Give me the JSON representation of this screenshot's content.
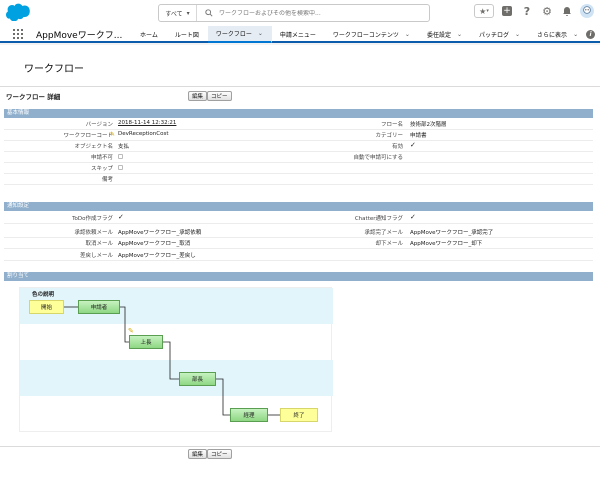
{
  "header": {
    "search_scope": "すべて",
    "search_placeholder": "ワークフローおよびその他を検索中..."
  },
  "nav": {
    "app_name": "AppMoveワークフ...",
    "tabs": [
      {
        "label": "ホーム",
        "has_menu": false
      },
      {
        "label": "ルート図",
        "has_menu": false
      },
      {
        "label": "ワークフロー",
        "has_menu": true,
        "active": true
      },
      {
        "label": "申請メニュー",
        "has_menu": false
      },
      {
        "label": "ワークフローコンテンツ",
        "has_menu": true
      },
      {
        "label": "委任設定",
        "has_menu": true
      },
      {
        "label": "パッチログ",
        "has_menu": true
      },
      {
        "label": "さらに表示",
        "has_menu": true
      }
    ]
  },
  "page": {
    "title": "ワークフロー",
    "detail_title": "ワークフロー 詳細",
    "edit_label": "編集",
    "copy_label": "コピー"
  },
  "basic": {
    "section_title": "基本情報",
    "rows": [
      {
        "l1": "バージョン",
        "v1": "2018-11-14 12:32:21",
        "l2": "フロー名",
        "v2": "技術部2次階層"
      },
      {
        "l1": "ワークフローコード",
        "v1": "DevReceptionCost",
        "l2": "カテゴリー",
        "v2": "申請書"
      },
      {
        "l1": "オブジェクト名",
        "v1": "支払",
        "l2": "有効",
        "v2": "✓"
      },
      {
        "l1": "申請不可",
        "v1": "",
        "l2": "自動で申請可にする",
        "v2": ""
      },
      {
        "l1": "スキップ",
        "v1": "",
        "l2": "",
        "v2": ""
      },
      {
        "l1": "備考",
        "v1": "",
        "l2": "",
        "v2": ""
      }
    ]
  },
  "notify": {
    "section_title": "通知設定",
    "rows": [
      {
        "l1": "ToDo作成フラグ",
        "v1": "✓",
        "l2": "Chatter通知フラグ",
        "v2": "✓"
      },
      {
        "l1": "承認依頼メール",
        "v1": "AppMoveワークフロー_承認依頼",
        "l2": "承認完了メール",
        "v2": "AppMoveワークフロー_承認完了"
      },
      {
        "l1": "取消メール",
        "v1": "AppMoveワークフロー_取消",
        "l2": "却下メール",
        "v2": "AppMoveワークフロー_却下"
      },
      {
        "l1": "差戻しメール",
        "v1": "AppMoveワークフロー_差戻し",
        "l2": "",
        "v2": ""
      }
    ]
  },
  "assign": {
    "section_title": "割り当て",
    "legend": "色の説明",
    "nodes": {
      "start": "開始",
      "applicant": "申請者",
      "boss": "上長",
      "manager": "部長",
      "accounting": "経理",
      "end": "終了"
    }
  },
  "colors": {
    "section_bar": "#8fafcc",
    "nav_accent": "#0176d3",
    "node_green": "#8fd784",
    "node_yellow": "#ffff99",
    "band": "#e1f5fb"
  }
}
